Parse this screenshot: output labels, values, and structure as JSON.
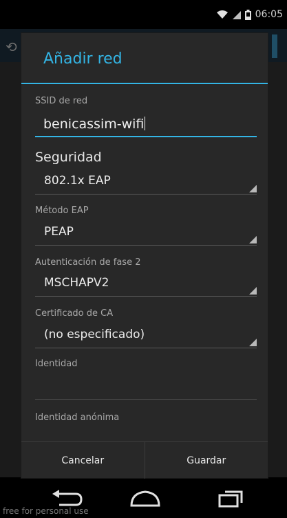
{
  "status": {
    "time": "06:05"
  },
  "dialog": {
    "title": "Añadir red",
    "ssid_label": "SSID de red",
    "ssid_value": "benicassim-wifi",
    "security_label": "Seguridad",
    "security_value": "802.1x EAP",
    "eap_label": "Método EAP",
    "eap_value": "PEAP",
    "phase2_label": "Autenticación de fase 2",
    "phase2_value": "MSCHAPV2",
    "ca_label": "Certificado de CA",
    "ca_value": "(no especificado)",
    "identity_label": "Identidad",
    "identity_value": "",
    "anon_label": "Identidad anónima",
    "cancel": "Cancelar",
    "save": "Guardar"
  },
  "navbar": {
    "icons": [
      "back-icon",
      "home-icon",
      "recents-icon"
    ]
  },
  "watermark": "free for personal use",
  "colors": {
    "accent": "#33b5e5",
    "dialog_bg": "#282828",
    "background": "#000000"
  }
}
